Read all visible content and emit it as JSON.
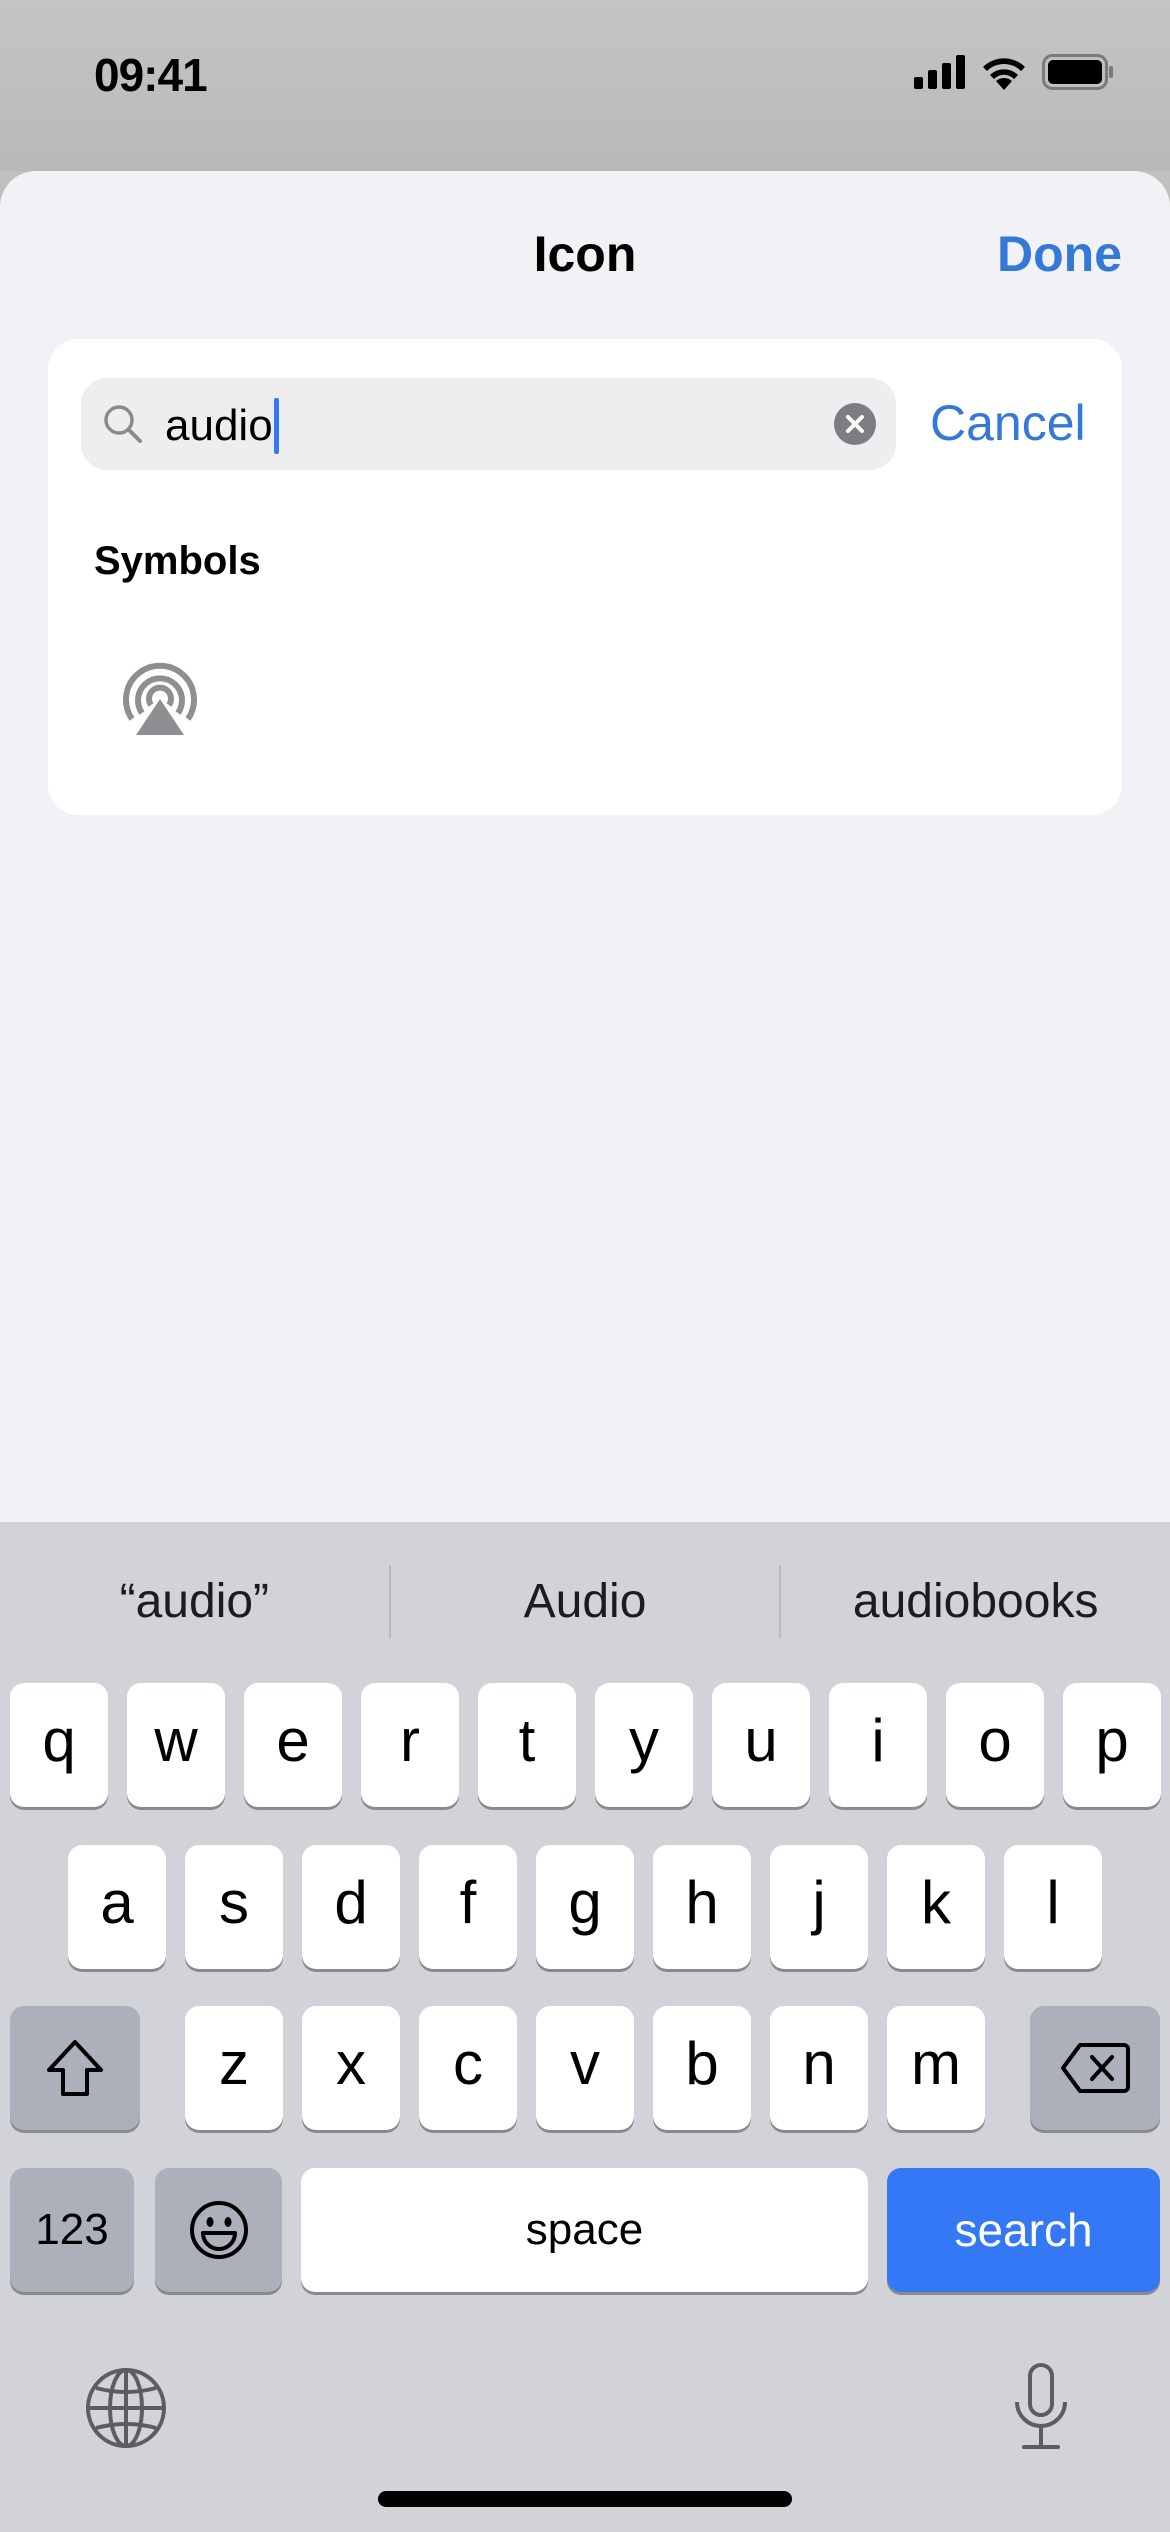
{
  "status_bar": {
    "time": "09:41",
    "icons": [
      "cellular-signal-icon",
      "wifi-icon",
      "battery-icon"
    ]
  },
  "sheet": {
    "title": "Icon",
    "done_label": "Done"
  },
  "search": {
    "value": "audio",
    "cancel_label": "Cancel",
    "icon": "magnifying-glass-icon",
    "clear_icon": "clear-x-icon"
  },
  "results": {
    "section_label": "Symbols",
    "symbols": [
      {
        "name": "airplay-audio-icon"
      }
    ]
  },
  "keyboard": {
    "suggestions": [
      "“audio”",
      "Audio",
      "audiobooks"
    ],
    "rows": [
      [
        "q",
        "w",
        "e",
        "r",
        "t",
        "y",
        "u",
        "i",
        "o",
        "p"
      ],
      [
        "a",
        "s",
        "d",
        "f",
        "g",
        "h",
        "j",
        "k",
        "l"
      ],
      [
        "z",
        "x",
        "c",
        "v",
        "b",
        "n",
        "m"
      ]
    ],
    "numbers_label": "123",
    "space_label": "space",
    "search_label": "search"
  },
  "colors": {
    "accent": "#3478d8",
    "search_key": "#3478f6",
    "keyboard_bg": "#d1d3d9",
    "sheet_bg": "#f1f1f6"
  }
}
